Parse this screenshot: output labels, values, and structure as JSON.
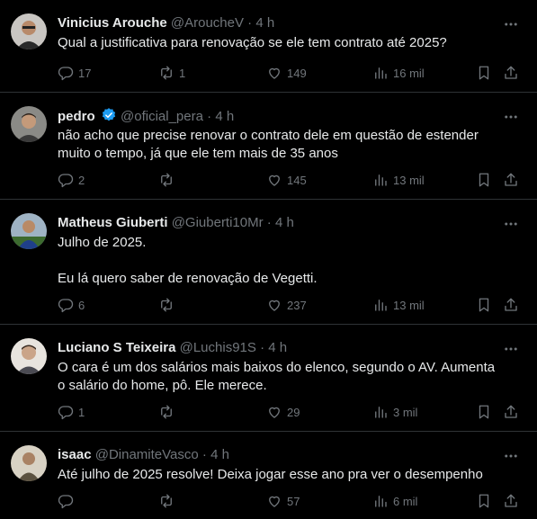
{
  "colors": {
    "background": "#000000",
    "text": "#e7e9ea",
    "muted": "#71767b",
    "divider": "#2f3336",
    "verified": "#1d9bf0"
  },
  "tweets": [
    {
      "name": "Vinicius Arouche",
      "handle": "@AroucheV",
      "dot": "·",
      "time": "4 h",
      "verified": false,
      "text": "Qual a justificativa para renovação se ele tem contrato até 2025?",
      "replies": "17",
      "retweets": "1",
      "likes": "149",
      "views": "16 mil"
    },
    {
      "name": "pedro",
      "handle": "@oficial_pera",
      "dot": "·",
      "time": "4 h",
      "verified": true,
      "text": "não acho que precise renovar o contrato dele em questão de estender muito o tempo, já que ele tem mais de 35 anos",
      "replies": "2",
      "retweets": "",
      "likes": "145",
      "views": "13 mil"
    },
    {
      "name": "Matheus Giuberti",
      "handle": "@Giuberti10Mr",
      "dot": "·",
      "time": "4 h",
      "verified": false,
      "text": "Julho de 2025.\n\nEu lá quero saber de renovação de Vegetti.",
      "replies": "6",
      "retweets": "",
      "likes": "237",
      "views": "13 mil"
    },
    {
      "name": "Luciano S Teixeira",
      "handle": "@Luchis91S",
      "dot": "·",
      "time": "4 h",
      "verified": false,
      "text": "O cara é um dos salários mais baixos do elenco, segundo o AV. Aumenta o salário do home, pô. Ele merece.",
      "replies": "1",
      "retweets": "",
      "likes": "29",
      "views": "3 mil"
    },
    {
      "name": "isaac",
      "handle": "@DinamiteVasco",
      "dot": "·",
      "time": "4 h",
      "verified": false,
      "text": "Até julho de 2025 resolve! Deixa jogar esse ano pra ver o desempenho",
      "replies": "",
      "retweets": "",
      "likes": "57",
      "views": "6 mil"
    }
  ]
}
